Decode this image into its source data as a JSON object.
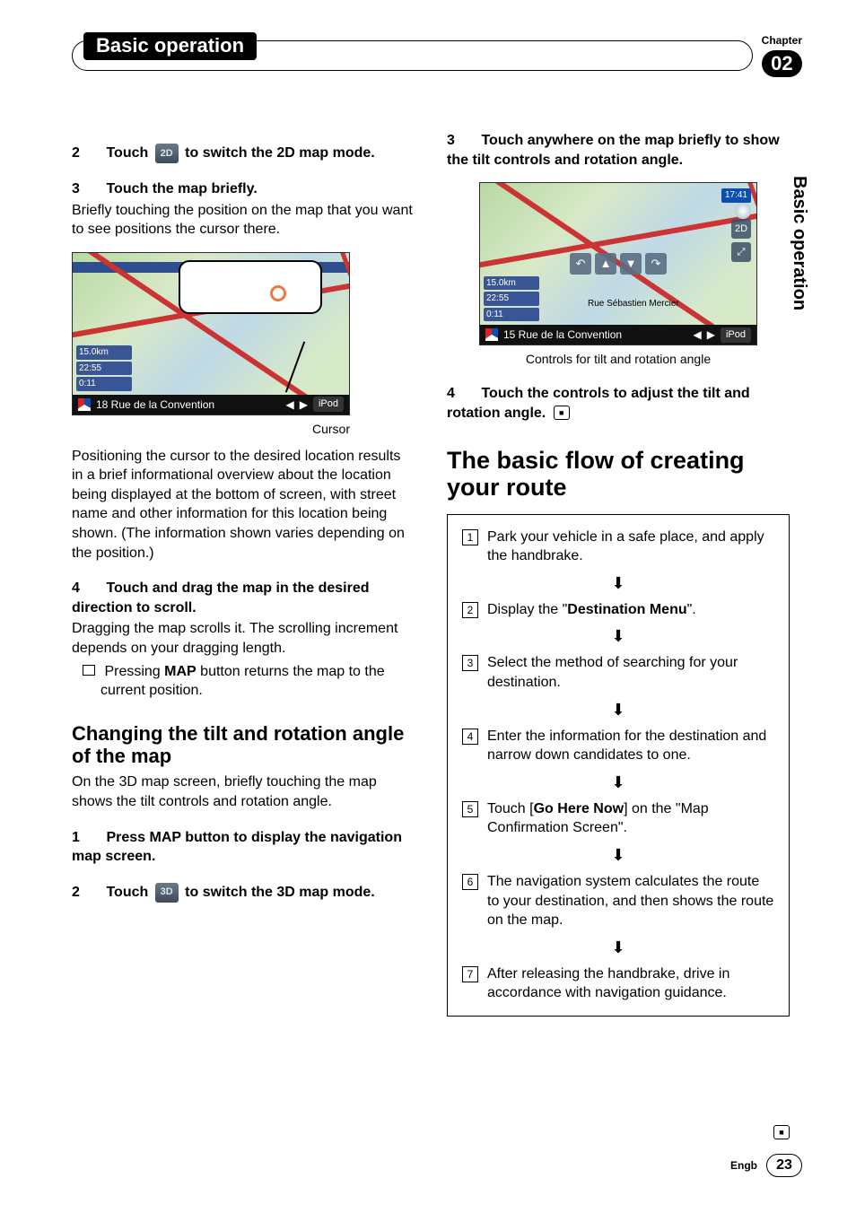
{
  "header": {
    "chapter_label": "Chapter",
    "section_title": "Basic operation",
    "chapter_number": "02",
    "side_tab": "Basic operation"
  },
  "left_col": {
    "steps": [
      {
        "num": "2",
        "pre": "Touch ",
        "icon": "2D",
        "post": " to switch the 2D map mode."
      },
      {
        "num": "3",
        "bold": "Touch the map briefly."
      }
    ],
    "p1": "Briefly touching the position on the map that you want to see positions the cursor there.",
    "map1": {
      "addr": "18 Rue de la Convention",
      "ipod": "iPod",
      "lp1": "15.0km",
      "lp2": "22:55",
      "lp3": "0:11"
    },
    "cursor_caption": "Cursor",
    "p2": "Positioning the cursor to the desired location results in a brief informational overview about the location being displayed at the bottom of screen, with street name and other information for this location being shown. (The information shown varies depending on the position.)",
    "step4_bold": "Touch and drag the map in the desired direction to scroll.",
    "step4_body": "Dragging the map scrolls it. The scrolling increment depends on your dragging length.",
    "note_pre": "Pressing ",
    "note_bold": "MAP",
    "note_post": " button returns the map to the current position.",
    "h2": "Changing the tilt and rotation angle of the map",
    "h2_body": "On the 3D map screen, briefly touching the map shows the tilt controls and rotation angle.",
    "step1_bottom": "Press MAP button to display the navigation map screen.",
    "step2_bottom_pre": "Touch ",
    "step2_bottom_icon": "3D",
    "step2_bottom_post": " to switch the 3D map mode."
  },
  "right_col": {
    "step3_bold": "Touch anywhere on the map briefly to show the tilt controls and rotation angle.",
    "map2": {
      "addr": "15 Rue de la Convention",
      "ipod": "iPod",
      "clock": "17:41",
      "lp1": "15.0km",
      "lp2": "22:55",
      "lp3": "0:11",
      "street1": "Rue Sébastien Mercier"
    },
    "map2_caption": "Controls for tilt and rotation angle",
    "step4_bold": "Touch the controls to adjust the tilt and rotation angle.",
    "h1": "The basic flow of creating your route",
    "flow": [
      {
        "n": "1",
        "t": "Park your vehicle in a safe place, and apply the handbrake."
      },
      {
        "n": "2",
        "t_pre": "Display the \"",
        "t_bold": "Destination Menu",
        "t_post": "\"."
      },
      {
        "n": "3",
        "t": "Select the method of searching for your destination."
      },
      {
        "n": "4",
        "t": "Enter the information for the destination and narrow down candidates to one."
      },
      {
        "n": "5",
        "t_pre": "Touch [",
        "t_bold": "Go Here Now",
        "t_post": "] on the \"Map Confirmation Screen\"."
      },
      {
        "n": "6",
        "t": "The navigation system calculates the route to your destination, and then shows the route on the map."
      },
      {
        "n": "7",
        "t": "After releasing the handbrake, drive in accordance with navigation guidance."
      }
    ]
  },
  "footer": {
    "lang": "Engb",
    "page": "23"
  },
  "icons": {
    "end": "■",
    "arrow": "⬇"
  }
}
